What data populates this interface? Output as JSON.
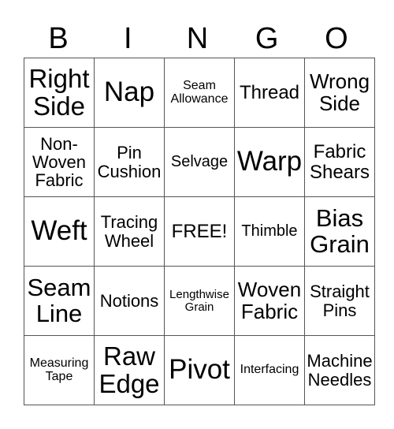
{
  "header": {
    "letters": [
      "B",
      "I",
      "N",
      "G",
      "O"
    ]
  },
  "grid": {
    "rows": [
      [
        "Right Side",
        "Nap",
        "Seam Allowance",
        "Thread",
        "Wrong Side"
      ],
      [
        "Non-Woven Fabric",
        "Pin Cushion",
        "Selvage",
        "Warp",
        "Fabric Shears"
      ],
      [
        "Weft",
        "Tracing Wheel",
        "FREE!",
        "Thimble",
        "Bias Grain"
      ],
      [
        "Seam Line",
        "Notions",
        "Lengthwise Grain",
        "Woven Fabric",
        "Straight Pins"
      ],
      [
        "Measuring Tape",
        "Raw Edge",
        "Pivot",
        "Interfacing",
        "Machine Needles"
      ]
    ],
    "free_space": "FREE!"
  }
}
